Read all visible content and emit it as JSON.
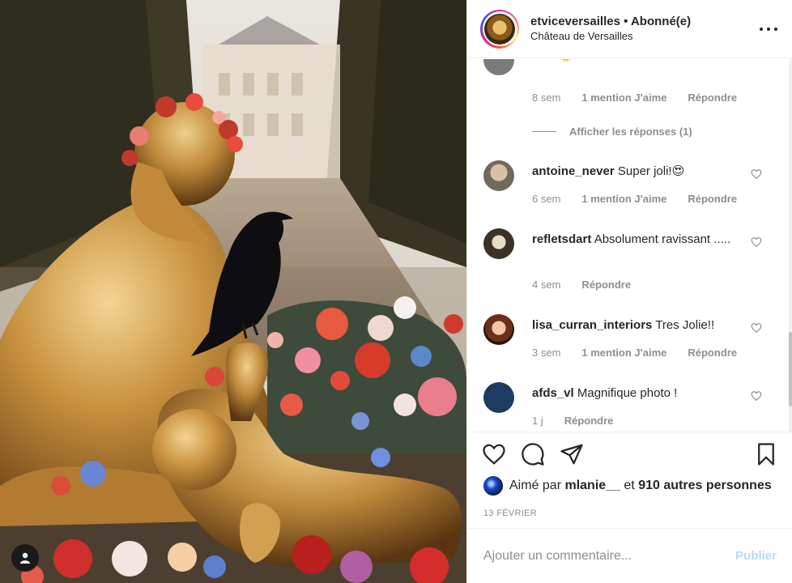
{
  "post": {
    "username": "etviceversailles",
    "separator": " • ",
    "follow_status": "Abonné(e)",
    "location": "Château de Versailles"
  },
  "comments": [
    {
      "text": "hola 🌞",
      "time": "8 sem",
      "likes": "1 mention J'aime",
      "reply": "Répondre"
    },
    {
      "username": "antoine_never",
      "text": "Super joli!😍",
      "time": "6 sem",
      "likes": "1 mention J'aime",
      "reply": "Répondre"
    },
    {
      "username": "refletsdart",
      "text": "Absolument ravissant .....",
      "time": "4 sem",
      "reply": "Répondre"
    },
    {
      "username": "lisa_curran_interiors",
      "text": "Tres Jolie!!",
      "time": "3 sem",
      "likes": "1 mention J'aime",
      "reply": "Répondre"
    },
    {
      "username": "afds_vl",
      "text": "Magnifique photo !",
      "time": "1 j",
      "reply": "Répondre"
    }
  ],
  "replies_toggle": "Afficher les réponses (1)",
  "likes": {
    "prefix": "Aimé par",
    "user": "mlanie__",
    "conj": "et",
    "others": "910 autres personnes"
  },
  "date": "13 FÉVRIER",
  "add_comment": {
    "placeholder": "Ajouter un commentaire...",
    "publish_label": "Publier"
  },
  "icons": [
    "user-tag-icon",
    "more-options-icon",
    "heart-icon",
    "comment-icon",
    "share-icon",
    "bookmark-icon"
  ],
  "colors": {
    "publish": "#b3dbff",
    "meta": "#8e8e8e",
    "text": "#262626"
  }
}
